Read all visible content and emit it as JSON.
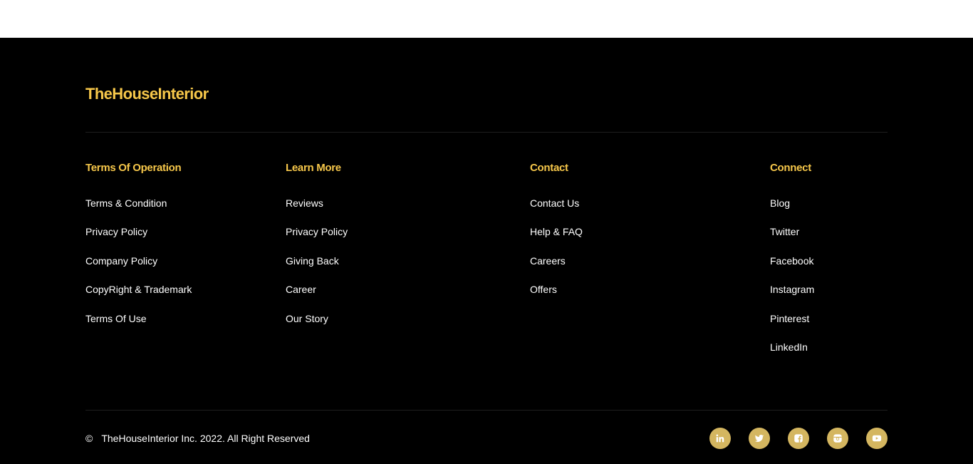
{
  "brand": {
    "name": "TheHouseInterior"
  },
  "columns": [
    {
      "heading": "Terms Of Operation",
      "links": [
        "Terms & Condition",
        "Privacy Policy",
        "Company Policy",
        "CopyRight & Trademark",
        "Terms Of Use"
      ]
    },
    {
      "heading": "Learn More",
      "links": [
        "Reviews",
        "Privacy Policy",
        "Giving Back",
        "Career",
        "Our Story"
      ]
    },
    {
      "heading": "Contact",
      "links": [
        "Contact Us",
        "Help & FAQ",
        "Careers",
        "Offers"
      ]
    },
    {
      "heading": "Connect",
      "links": [
        "Blog",
        "Twitter",
        "Facebook",
        "Instagram",
        "Pinterest",
        "LinkedIn"
      ]
    }
  ],
  "copyright": {
    "symbol": "©",
    "text": "TheHouseInterior Inc. 2022. All Right Reserved"
  },
  "social_icons": [
    "linkedin-icon",
    "twitter-icon",
    "facebook-icon",
    "instagram-icon",
    "youtube-icon"
  ],
  "colors": {
    "accent": "#f6c74a",
    "icon_bg": "#d4b660",
    "background": "#000000",
    "text": "#ffffff"
  }
}
